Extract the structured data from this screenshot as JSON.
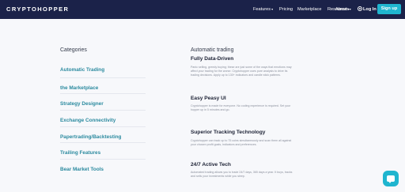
{
  "header": {
    "logo": "CRYPTOHOPPER",
    "nav": [
      {
        "label": "Features",
        "dropdown": true
      },
      {
        "label": "Pricing",
        "dropdown": false
      },
      {
        "label": "Marketplace",
        "dropdown": false
      },
      {
        "label": "Resources",
        "dropdown": true
      },
      {
        "label": "About",
        "dropdown": true
      }
    ],
    "login_label": "Log In",
    "signup_label": "Sign up",
    "caret": "▾"
  },
  "categories": {
    "heading": "Categories",
    "items": [
      "Automatic Trading",
      "the Marketplace",
      "Strategy Designer",
      "Exchange Connectivity",
      "Papertrading/Backtesting",
      "Trailing Features",
      "Bear Market Tools"
    ]
  },
  "section": {
    "heading": "Automatic trading",
    "features": [
      {
        "title": "Fully Data-Driven",
        "lines": [
          "Panic selling, greedy buying; these are just some of the ways that emotions may",
          "affect your trading for the worse. Cryptohopper uses pure analysis to drive its",
          "trading decisions. Apply up to 130+ indicators and candle stick patterns."
        ]
      },
      {
        "title": "Easy Peasy UI",
        "lines": [
          "Cryptohopper is made for everyone. No coding experience is required. Set your",
          "hopper up in 5 minutes and go."
        ]
      },
      {
        "title": "Superior Tracking Technology",
        "lines": [
          "Cryptohopper can track up to 75 coins simultaneously and scan them all against",
          "your chosen profit goals, indicators and preferences."
        ]
      },
      {
        "title": "24/7 Active Tech",
        "lines": [
          "Automated trading allows you to trade 24/7 days, 365 days a year. It buys, tracks",
          "and sells your investments while you sleep."
        ]
      }
    ]
  },
  "colors": {
    "header_bg": "#1b2249",
    "accent": "#1fb5cf",
    "link": "#2b8a9f"
  },
  "icons": {
    "login": "user-icon",
    "chat": "chat-icon"
  }
}
